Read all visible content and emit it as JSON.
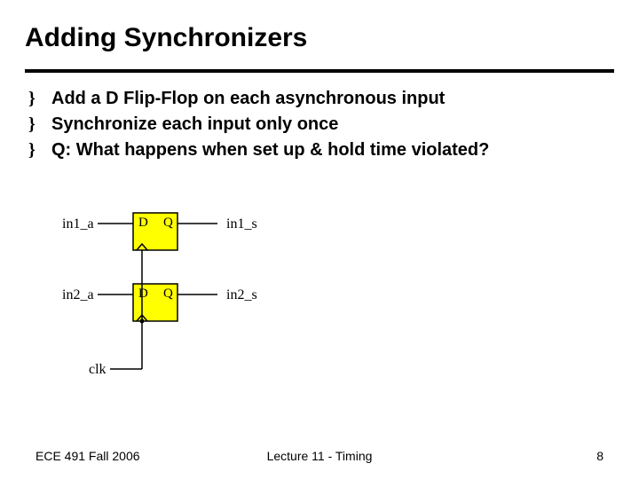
{
  "title": "Adding Synchronizers",
  "bullets": {
    "marker": "}",
    "items": [
      "Add a D Flip-Flop on each asynchronous input",
      "Synchronize each input only once",
      "Q: What happens when set up & hold time violated?"
    ]
  },
  "ff": {
    "d": "D",
    "q": "Q"
  },
  "signals": {
    "in1_a": "in1_a",
    "in1_s": "in1_s",
    "in2_a": "in2_a",
    "in2_s": "in2_s",
    "clk": "clk"
  },
  "colors": {
    "ff_fill": "#ffff00",
    "stroke": "#000000"
  },
  "footer": {
    "left": "ECE 491 Fall 2006",
    "center": "Lecture 11 - Timing",
    "page": "8"
  }
}
